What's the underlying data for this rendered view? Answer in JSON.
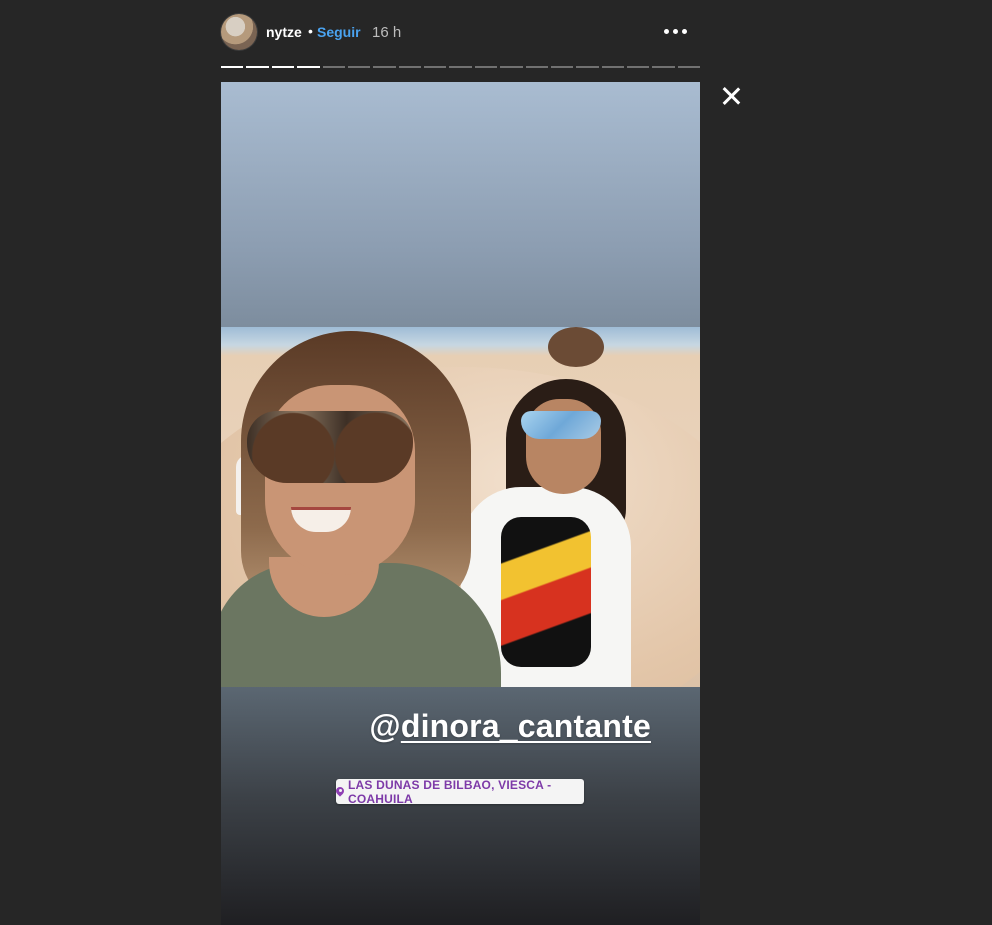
{
  "header": {
    "username": "nytze",
    "separator": "•",
    "follow_label": "Seguir",
    "time": "16 h"
  },
  "progress": {
    "segments_total": 19,
    "segments_completed": 4
  },
  "story": {
    "mention_prefix": "@",
    "mention_handle": "dinora_cantante",
    "location_label": "LAS DUNAS DE BILBAO, VIESCA - COAHUILA"
  },
  "icons": {
    "more": "more-options-icon",
    "close": "close-icon",
    "location": "location-pin-icon"
  },
  "colors": {
    "background": "#262626",
    "follow": "#4aa3f0",
    "location_text": "#7d3aa8"
  }
}
